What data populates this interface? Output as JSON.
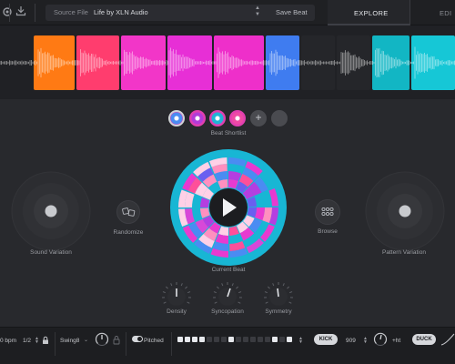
{
  "header": {
    "source_label": "Source File",
    "source_value": "Life by XLN Audio",
    "save_label": "Save Beat",
    "tab_explore": "EXPLORE",
    "tab_edit": "EDI",
    "colors": {
      "bar_bg": "#1f2023"
    }
  },
  "sequence": {
    "pads": [
      {
        "color": "#ff7a14"
      },
      {
        "color": "#ff3d6e"
      },
      {
        "color": "#f236c8"
      },
      {
        "color": "#e72fd6"
      },
      {
        "color": "#ee2fca"
      },
      {
        "color": "#3f7cf0"
      },
      {
        "color": "#25262a"
      },
      {
        "color": "#25262a"
      },
      {
        "color": "#12b6c4"
      },
      {
        "color": "#16c7d6"
      }
    ]
  },
  "shortlist": {
    "caption": "Beat Shortlist",
    "items": [
      {
        "color": "#4a8cf2"
      },
      {
        "color": "#b23bd8"
      },
      {
        "color": "#20b4d6"
      },
      {
        "color": "#ee4aa4"
      }
    ],
    "add_symbol": "+"
  },
  "controls": {
    "sound_variation": "Sound Variation",
    "randomize": "Randomize",
    "current_beat": "Current Beat",
    "browse": "Browse",
    "pattern_variation": "Pattern Variation",
    "density": "Density",
    "syncopation": "Syncopation",
    "symmetry": "Symmetry"
  },
  "transport": {
    "tempo": "0 bpm",
    "division": "1/2",
    "swing_label": "Swing8",
    "pitched_label": "Pitched",
    "steps": [
      1,
      1,
      1,
      1,
      0,
      0,
      0,
      1,
      0,
      0,
      0,
      0,
      0,
      1,
      0,
      1
    ],
    "kick_label": "KICK",
    "kit_value": "909",
    "offset_value": "+ht",
    "duck_label": "DUCK"
  }
}
